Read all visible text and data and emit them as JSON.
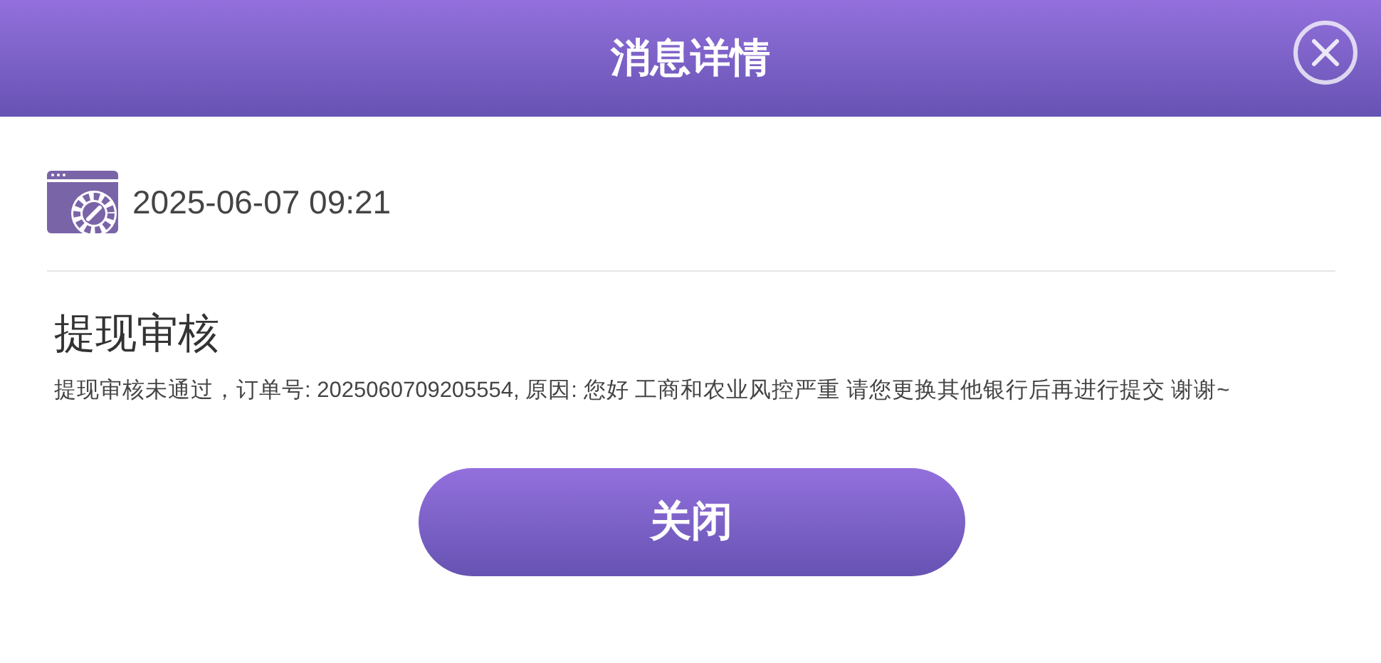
{
  "header": {
    "title": "消息详情"
  },
  "message": {
    "time": "2025-06-07 09:21",
    "title": "提现审核",
    "body": "提现审核未通过，订单号: 2025060709205554, 原因: 您好 工商和农业风控严重 请您更换其他银行后再进行提交 谢谢~"
  },
  "buttons": [
    "关闭"
  ]
}
